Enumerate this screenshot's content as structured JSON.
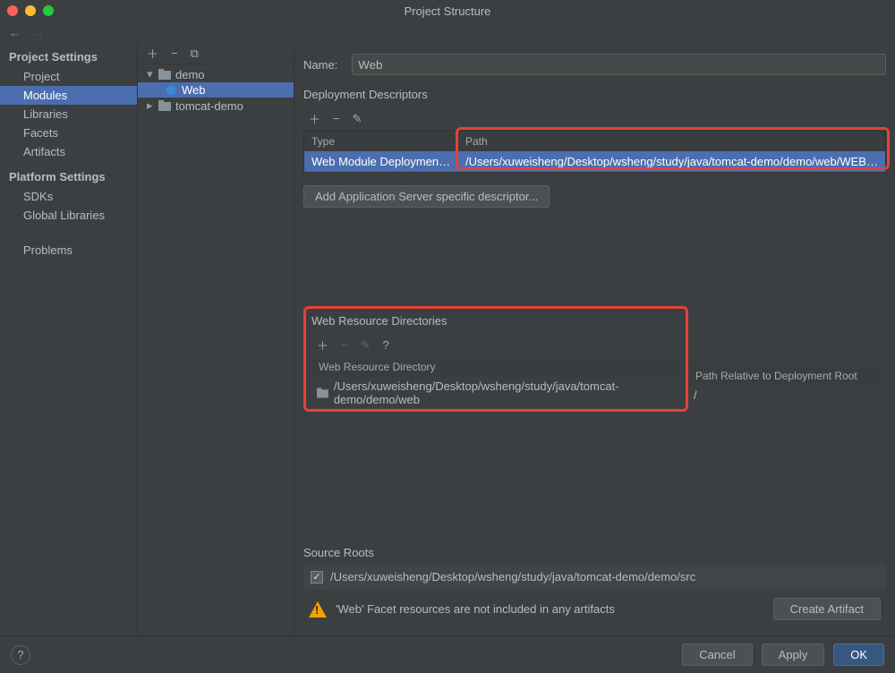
{
  "window": {
    "title": "Project Structure"
  },
  "sidebar": {
    "project_settings_header": "Project Settings",
    "platform_settings_header": "Platform Settings",
    "items_project": "Project",
    "items_modules": "Modules",
    "items_libraries": "Libraries",
    "items_facets": "Facets",
    "items_artifacts": "Artifacts",
    "items_sdks": "SDKs",
    "items_globallib": "Global Libraries",
    "items_problems": "Problems"
  },
  "tree": {
    "demo": "demo",
    "web": "Web",
    "tomcat": "tomcat-demo"
  },
  "panel": {
    "name_label": "Name:",
    "name_value": "Web",
    "deploy_header": "Deployment Descriptors",
    "col_type": "Type",
    "col_path": "Path",
    "row_type": "Web Module Deployment Des...",
    "row_path": "/Users/xuweisheng/Desktop/wsheng/study/java/tomcat-demo/demo/web/WEB-INF/web.xml",
    "add_server_btn": "Add Application Server specific descriptor...",
    "wrd_header": "Web Resource Directories",
    "wrd_col1": "Web Resource Directory",
    "wrd_col2": "Path Relative to Deployment Root",
    "wrd_row_path": "/Users/xuweisheng/Desktop/wsheng/study/java/tomcat-demo/demo/web",
    "wrd_row_rel": "/",
    "source_roots_header": "Source Roots",
    "source_root_path": "/Users/xuweisheng/Desktop/wsheng/study/java/tomcat-demo/demo/src",
    "warning_text": "'Web' Facet resources are not included in any artifacts",
    "create_artifact_btn": "Create Artifact"
  },
  "footer": {
    "cancel": "Cancel",
    "apply": "Apply",
    "ok": "OK"
  }
}
